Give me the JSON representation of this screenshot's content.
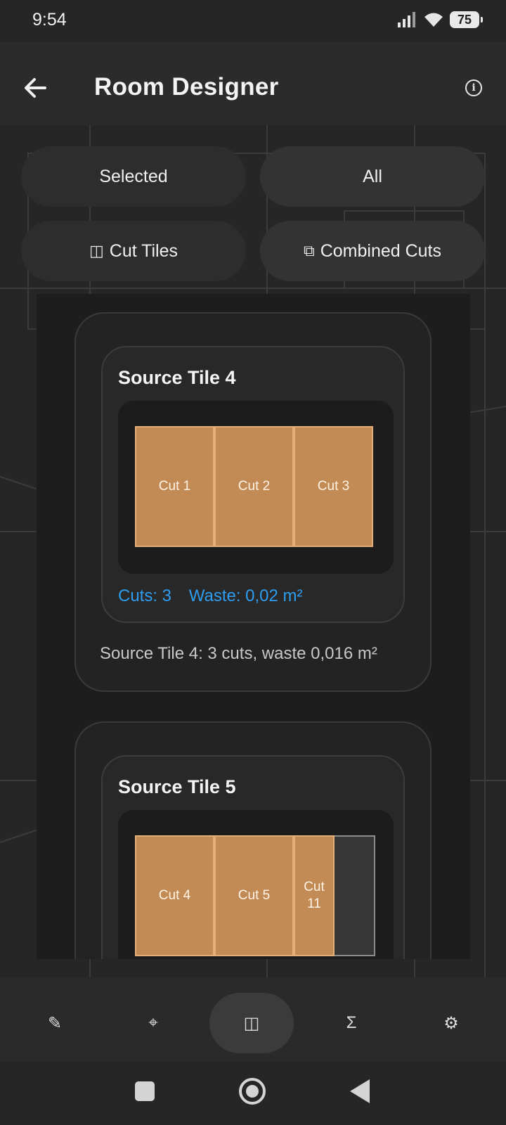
{
  "status_bar": {
    "time": "9:54",
    "battery": "75",
    "icons": [
      "signal-icon",
      "wifi-icon",
      "battery-icon"
    ]
  },
  "app_bar": {
    "title": "Room Designer",
    "back_icon": "arrow-left-icon",
    "info_icon": "info-icon"
  },
  "scope_toggle": {
    "selected_label": "Selected",
    "all_label": "All"
  },
  "view_toggle": {
    "cut_tiles_icon": "◫",
    "cut_tiles_label": "Cut Tiles",
    "combined_cuts_icon": "⧉",
    "combined_cuts_label": "Combined Cuts"
  },
  "source_tiles": [
    {
      "title": "Source Tile 4",
      "cuts": [
        {
          "label": "Cut 1",
          "width_fraction": 0.33
        },
        {
          "label": "Cut 2",
          "width_fraction": 0.33
        },
        {
          "label": "Cut 3",
          "width_fraction": 0.33
        }
      ],
      "waste_fraction": 0,
      "stats_cuts": "Cuts: 3",
      "stats_waste": "Waste: 0,02 m²",
      "summary": "Source Tile 4: 3 cuts, waste 0,016 m²"
    },
    {
      "title": "Source Tile 5",
      "cuts": [
        {
          "label": "Cut 4",
          "width_fraction": 0.33
        },
        {
          "label": "Cut 5",
          "width_fraction": 0.33
        },
        {
          "label": "Cut\n11",
          "width_fraction": 0.17
        }
      ],
      "waste_fraction": 0.17
    }
  ],
  "bottom_nav": [
    {
      "icon": "✎",
      "name": "pencil-icon",
      "active": false
    },
    {
      "icon": "⌖",
      "name": "crosshair-icon",
      "active": false
    },
    {
      "icon": "◫",
      "name": "cut-tiles-icon",
      "active": true
    },
    {
      "icon": "Σ",
      "name": "sum-icon",
      "active": false
    },
    {
      "icon": "⚙",
      "name": "settings-icon",
      "active": false
    }
  ],
  "colors": {
    "accent_text": "#2e9df0",
    "cut_fill": "#c28a54",
    "cut_border": "#e4ae78",
    "background": "#262626"
  }
}
